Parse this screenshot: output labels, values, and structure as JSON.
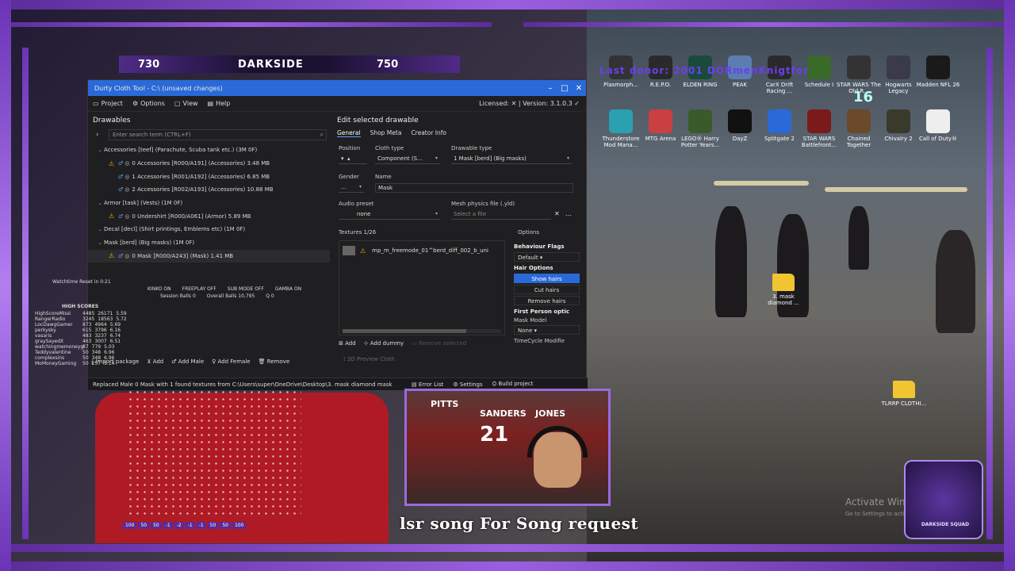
{
  "scoreboard": {
    "left_score": "730",
    "center_label": "DARKSIDE",
    "right_score": "750"
  },
  "window": {
    "title": "Durty Cloth Tool - C:\\ (unsaved changes)",
    "minimize": "–",
    "maximize": "□",
    "close": "✕"
  },
  "menu": {
    "project": "Project",
    "options": "Options",
    "view": "View",
    "help": "Help",
    "license": "Licensed: ✕ | Version: 3.1.0.3 ✓"
  },
  "left": {
    "header": "Drawables",
    "search_placeholder": "Enter search term (CTRL+F)",
    "tree": [
      {
        "label": "Accessories [teef] (Parachute, Scuba tank etc.) (3M 0F)",
        "level": 0,
        "group": true
      },
      {
        "label": "0 Accessories [R000/A191] (Accessories) 3.48 MB",
        "level": 1,
        "warn": true
      },
      {
        "label": "1 Accessories [R001/A192] (Accessories) 6.85 MB",
        "level": 1,
        "warn": false
      },
      {
        "label": "2 Accessories [R002/A193] (Accessories) 10.88 MB",
        "level": 1,
        "warn": false
      },
      {
        "label": "Armor [task] (Vests) (1M 0F)",
        "level": 0,
        "group": true
      },
      {
        "label": "0 Undershirt [R000/A061] (Armor) 5.89 MB",
        "level": 1,
        "warn": true
      },
      {
        "label": "Decal [decl] (Shirt printings, Emblems etc) (1M 0F)",
        "level": 0,
        "group": true
      },
      {
        "label": "Mask [berd] (Big masks) (1M 0F)",
        "level": 0,
        "group": true
      },
      {
        "label": "0 Mask [R000/A243] (Mask) 1.41 MB",
        "level": 1,
        "warn": true,
        "selected": true
      }
    ],
    "buttons": {
      "import": "Import package",
      "add": "Add",
      "add_male": "Add Male",
      "add_female": "Add Female",
      "remove": "Remove"
    }
  },
  "right": {
    "header": "Edit selected drawable",
    "tabs": [
      "General",
      "Shop Meta",
      "Creator Info"
    ],
    "labels": {
      "position": "Position",
      "cloth_type": "Cloth type",
      "drawable_type": "Drawable type",
      "gender": "Gender",
      "name": "Name",
      "audio": "Audio preset",
      "mesh": "Mesh physics file (.yld)",
      "textures": "Textures 1/26",
      "options": "Options"
    },
    "values": {
      "cloth_type": "Component (S...",
      "drawable_type": "1   Mask [berd] (Big masks)",
      "gender": "...",
      "name": "Mask",
      "audio": "none",
      "mesh_placeholder": "Select a file"
    },
    "texture": "mp_m_freemode_01^berd_diff_002_b_uni",
    "opts": {
      "behaviour": "Behaviour Flags",
      "default": "Default",
      "hair": "Hair Options",
      "show": "Show hairs",
      "cut": "Cut hairs",
      "remove": "Remove hairs",
      "first_person": "First Person optic",
      "mask_model": "Mask Model",
      "none": "None",
      "timecycle": "TimeCycle Modifie"
    },
    "add": "Add",
    "add_dummy": "Add dummy",
    "remove_selected": "Remove selected",
    "preview": "3D Preview Cloth"
  },
  "status": {
    "message": "Replaced Male 0 Mask with 1 found textures from C:\\Users\\super\\OneDrive\\Desktop\\3. mask diamond mask",
    "errors": "Error List",
    "settings": "Settings",
    "build": "Build project"
  },
  "stats": {
    "watchtime": "Watchtime Reset in 0:21",
    "kinko": "KINKO ON",
    "freeplay": "FREEPLAY OFF",
    "submode": "SUB MODE OFF",
    "gamba": "GAMBA ON",
    "session": "Session Balls  0",
    "overall": "Overall Balls  10,795",
    "q": "Q  0",
    "high_scores": "HIGH SCORES",
    "hs": [
      {
        "n": "HighScoreMissi",
        "a": "4485",
        "b": "26171",
        "c": "5.59"
      },
      {
        "n": "RangerRadio",
        "a": "3245",
        "b": "18563",
        "c": "5.72"
      },
      {
        "n": "LocDawgGamer",
        "a": "873",
        "b": "4964",
        "c": "5.69"
      },
      {
        "n": "perkysky",
        "a": "615",
        "b": "3796",
        "c": "6.16"
      },
      {
        "n": "vasaris",
        "a": "483",
        "b": "3237",
        "c": "6.74"
      },
      {
        "n": "graySayedX",
        "a": "463",
        "b": "3007",
        "c": "6.51"
      },
      {
        "n": "watchingmemoneyg",
        "a": "87",
        "b": "779",
        "c": "5.03"
      },
      {
        "n": "Teddyvalentine",
        "a": "50",
        "b": "348",
        "c": "6.96"
      },
      {
        "n": "complexsins",
        "a": "50",
        "b": "348",
        "c": "6.96"
      },
      {
        "n": "MoMoneyGaming",
        "a": "50",
        "b": "257",
        "c": "5.14"
      }
    ]
  },
  "desktop_icons": [
    {
      "label": "Plasmorph...",
      "color": "#333"
    },
    {
      "label": "R.E.P.O.",
      "color": "#2a2a2a"
    },
    {
      "label": "ELDEN RING",
      "color": "#1a4a3a"
    },
    {
      "label": "PEAK",
      "color": "#5b7db1"
    },
    {
      "label": "CarX Drift Racing ...",
      "color": "#2a2a2a"
    },
    {
      "label": "Schedule I",
      "color": "#3a6a2a"
    },
    {
      "label": "STAR WARS The Old R...",
      "color": "#333"
    },
    {
      "label": "Hogwarts Legacy",
      "color": "#3a3a4a"
    },
    {
      "label": "Madden NFL 26",
      "color": "#1a1a1a"
    },
    {
      "label": "Thunderstore Mod Mana...",
      "color": "#2aa0b0"
    },
    {
      "label": "MTG Arena",
      "color": "#c94040"
    },
    {
      "label": "LEGO® Harry Potter Years...",
      "color": "#3a5a2a"
    },
    {
      "label": "DayZ",
      "color": "#111"
    },
    {
      "label": "Splitgate 2",
      "color": "#2a6ad8"
    },
    {
      "label": "STAR WARS Battlefront...",
      "color": "#7a1a1a"
    },
    {
      "label": "Chained Together",
      "color": "#6a4a2a"
    },
    {
      "label": "Chivalry 2",
      "color": "#3a3a2a"
    },
    {
      "label": "Call of Duty®",
      "color": "#eee"
    }
  ],
  "folders": {
    "diamond": "3. mask diamond ...",
    "tlrp": "TLRRP CLOTHI..."
  },
  "overlay": {
    "ticker": "lsr song For Song request",
    "top_text": "Last donor: 2001 DORmenKnigtfor",
    "big_num": "16",
    "chat_vals": [
      "100",
      "50",
      "50",
      "-1",
      "-2",
      "-1",
      "-1",
      "50",
      "50",
      "100"
    ],
    "watermark": "Activate Windows",
    "watermark_sub": "Go to Settings to activate",
    "logo_text": "DARKSIDE SQUAD",
    "cam_jersey": [
      "PITTS",
      "SANDERS",
      "21",
      "JONES"
    ]
  }
}
